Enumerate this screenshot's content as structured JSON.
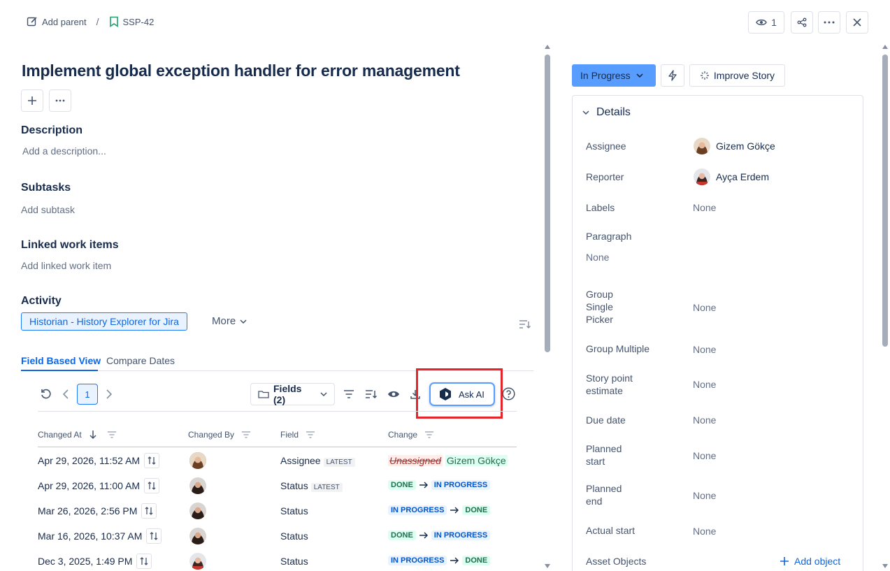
{
  "breadcrumb": {
    "add_parent": "Add parent",
    "separator": "/",
    "issue_key": "SSP-42"
  },
  "top_actions": {
    "watchers_count": "1"
  },
  "issue": {
    "title": "Implement global exception handler for error management"
  },
  "description": {
    "heading": "Description",
    "placeholder": "Add a description..."
  },
  "subtasks": {
    "heading": "Subtasks",
    "placeholder": "Add subtask"
  },
  "linked": {
    "heading": "Linked work items",
    "placeholder": "Add linked work item"
  },
  "activity": {
    "heading": "Activity",
    "historian_label": "Historian - History Explorer for Jira",
    "more_label": "More"
  },
  "tabs": [
    {
      "label": "Field Based View",
      "active": true
    },
    {
      "label": "Compare Dates",
      "active": false
    }
  ],
  "toolbar": {
    "page": "1",
    "fields_label": "Fields (2)",
    "ask_ai_label": "Ask AI"
  },
  "table": {
    "columns": [
      "Changed At",
      "Changed By",
      "Field",
      "Change"
    ],
    "rows": [
      {
        "changed_at": "Apr 29, 2026, 11:52 AM",
        "field": "Assignee",
        "latest": "LATEST",
        "from": "Unassigned",
        "to": "Gizem Gökçe",
        "kind": "text"
      },
      {
        "changed_at": "Apr 29, 2026, 11:00 AM",
        "field": "Status",
        "latest": "LATEST",
        "from": "DONE",
        "to": "IN PROGRESS",
        "kind": "status"
      },
      {
        "changed_at": "Mar 26, 2026, 2:56 PM",
        "field": "Status",
        "latest": "",
        "from": "IN PROGRESS",
        "to": "DONE",
        "kind": "status"
      },
      {
        "changed_at": "Mar 16, 2026, 10:37 AM",
        "field": "Status",
        "latest": "",
        "from": "DONE",
        "to": "IN PROGRESS",
        "kind": "status"
      },
      {
        "changed_at": "Dec 3, 2025, 1:49 PM",
        "field": "Status",
        "latest": "",
        "from": "IN PROGRESS",
        "to": "DONE",
        "kind": "status"
      }
    ]
  },
  "right": {
    "status_label": "In Progress",
    "improve_label": "Improve Story",
    "details_heading": "Details",
    "fields": {
      "assignee": {
        "label": "Assignee",
        "value": "Gizem Gökçe"
      },
      "reporter": {
        "label": "Reporter",
        "value": "Ayça Erdem"
      },
      "labels": {
        "label": "Labels",
        "value": "None"
      },
      "paragraph": {
        "label": "Paragraph",
        "value": "None"
      },
      "group_single": {
        "label_l1": "Group",
        "label_l2": "Single",
        "label_l3": "Picker",
        "value": "None"
      },
      "group_multiple": {
        "label": "Group Multiple",
        "value": "None"
      },
      "story_points": {
        "label_l1": "Story point",
        "label_l2": "estimate",
        "value": "None"
      },
      "due_date": {
        "label": "Due date",
        "value": "None"
      },
      "planned_start": {
        "label_l1": "Planned",
        "label_l2": "start",
        "value": "None"
      },
      "planned_end": {
        "label_l1": "Planned",
        "label_l2": "end",
        "value": "None"
      },
      "actual_start": {
        "label": "Actual start",
        "value": "None"
      },
      "asset_objects": {
        "label": "Asset Objects",
        "action": "Add object"
      }
    }
  },
  "colors": {
    "accent": "#0c66e4",
    "status_button": "#579dff",
    "highlight_box": "#e5252a"
  }
}
